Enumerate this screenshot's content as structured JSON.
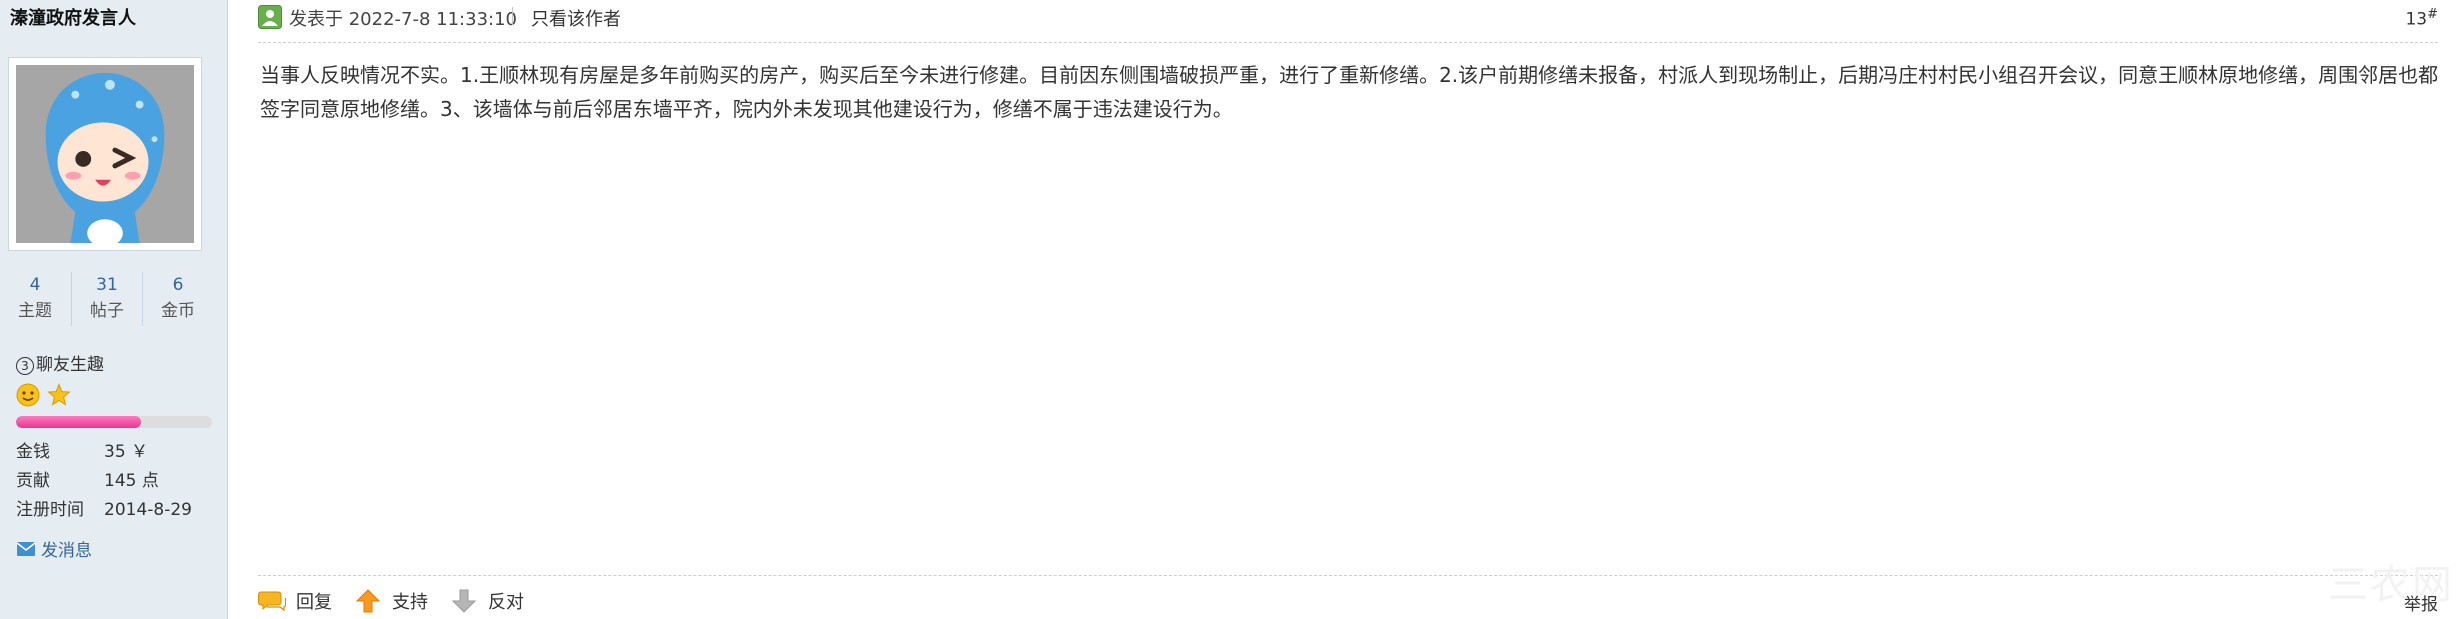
{
  "user": {
    "name": "溱潼政府发言人",
    "stats": [
      {
        "num": "4",
        "label": "主题"
      },
      {
        "num": "31",
        "label": "帖子"
      },
      {
        "num": "6",
        "label": "金币"
      }
    ],
    "group_num": "3",
    "group": "聊友生趣",
    "level_progress": 0.64,
    "info": [
      {
        "key": "金钱",
        "value": "35 ￥"
      },
      {
        "key": "贡献",
        "value": "145 点"
      },
      {
        "key": "注册时间",
        "value": "2014-8-29"
      }
    ],
    "send_message": "发消息"
  },
  "post": {
    "time": "发表于 2022-7-8 11:33:10",
    "only_author": "只看该作者",
    "floor_num": "13",
    "floor_mark": "#",
    "content": "当事人反映情况不实。1.王顺林现有房屋是多年前购买的房产，购买后至今未进行修建。目前因东侧围墙破损严重，进行了重新修缮。2.该户前期修缮未报备，村派人到现场制止，后期冯庄村村民小组召开会议，同意王顺林原地修缮，周围邻居也都签字同意原地修缮。3、该墙体与前后邻居东墙平齐，院内外未发现其他建设行为，修缮不属于违法建设行为。"
  },
  "actions": {
    "reply": "回复",
    "support": "支持",
    "oppose": "反对",
    "report": "举报"
  },
  "watermark": "三农网",
  "colors": {
    "sidebar_bg": "#e5edf2",
    "link": "#336699",
    "progress": "#e8368f"
  }
}
